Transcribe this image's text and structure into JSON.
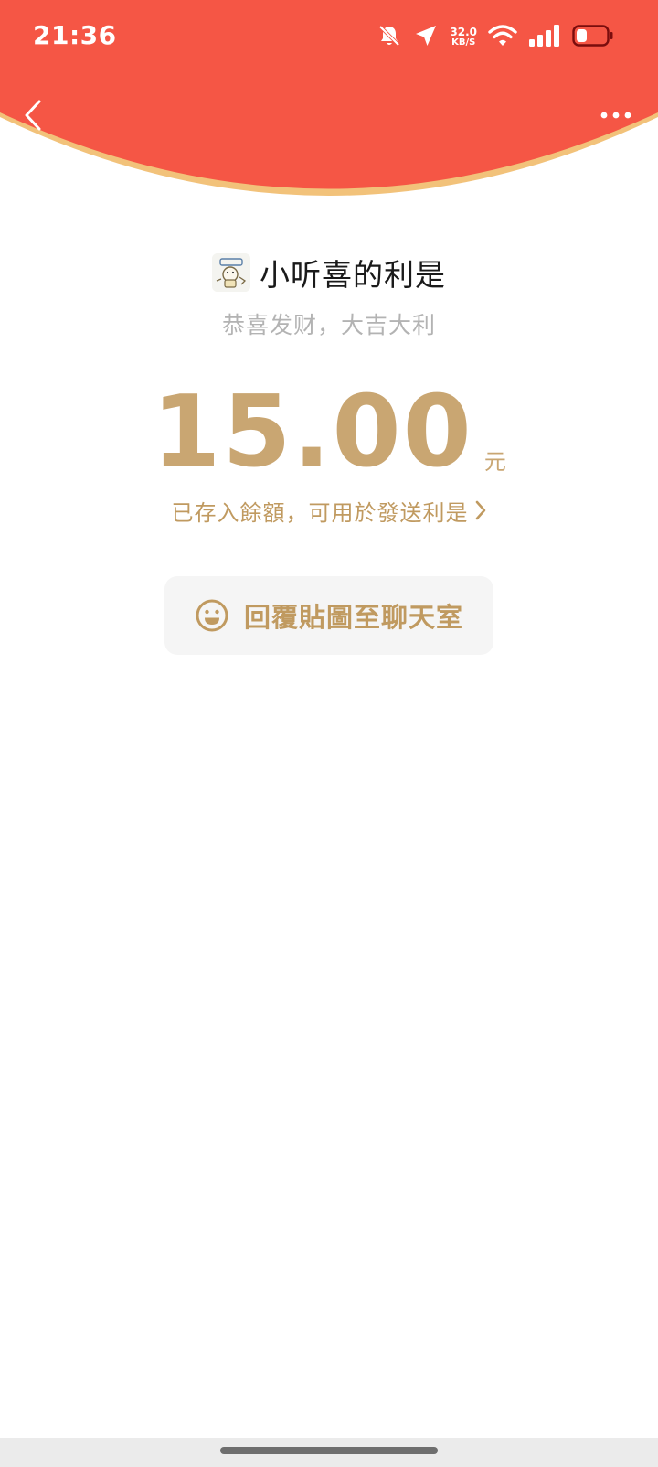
{
  "status_bar": {
    "time": "21:36",
    "net_speed_value": "32.0",
    "net_speed_unit": "KB/S",
    "icons": [
      "bell-muted-icon",
      "location-arrow-icon",
      "wifi-icon",
      "signal-icon",
      "battery-icon"
    ]
  },
  "nav": {
    "back_icon": "chevron-left-icon",
    "more_icon": "more-dots-icon"
  },
  "packet": {
    "sender_name": "小听喜的利是",
    "blessing": "恭喜发财，大吉大利",
    "amount": "15.00",
    "unit": "元",
    "balance_link": "已存入餘額，可用於發送利是"
  },
  "reply": {
    "label": "回覆貼圖至聊天室",
    "icon": "smiley-icon"
  },
  "colors": {
    "header_red": "#f55645",
    "header_rim": "#f2c27a",
    "gold": "#c9a672",
    "gold_text": "#c09a60",
    "muted_text": "#b3b3b3",
    "button_bg": "#f5f5f5"
  }
}
